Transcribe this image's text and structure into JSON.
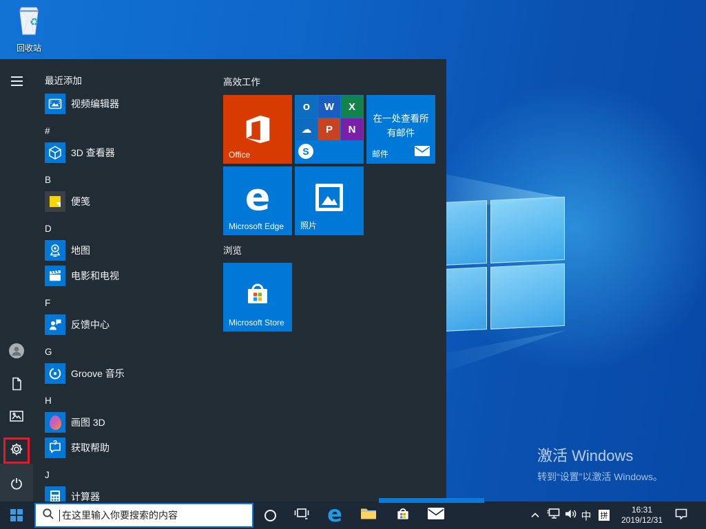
{
  "desktop": {
    "recycle_bin_label": "回收站",
    "watermark": {
      "title": "激活 Windows",
      "subtitle": "转到“设置”以激活 Windows。"
    }
  },
  "start_menu": {
    "app_list": {
      "items": [
        {
          "type": "header",
          "label": "最近添加"
        },
        {
          "type": "app",
          "label": "视频编辑器",
          "icon": "video-editor-icon"
        },
        {
          "type": "header",
          "label": "#"
        },
        {
          "type": "app",
          "label": "3D 查看器",
          "icon": "3d-viewer-icon"
        },
        {
          "type": "header",
          "label": "B"
        },
        {
          "type": "app",
          "label": "便笺",
          "icon": "sticky-notes-icon"
        },
        {
          "type": "header",
          "label": "D"
        },
        {
          "type": "app",
          "label": "地图",
          "icon": "maps-icon"
        },
        {
          "type": "app",
          "label": "电影和电视",
          "icon": "movies-tv-icon"
        },
        {
          "type": "header",
          "label": "F"
        },
        {
          "type": "app",
          "label": "反馈中心",
          "icon": "feedback-hub-icon"
        },
        {
          "type": "header",
          "label": "G"
        },
        {
          "type": "app",
          "label": "Groove 音乐",
          "icon": "groove-music-icon"
        },
        {
          "type": "header",
          "label": "H"
        },
        {
          "type": "app",
          "label": "画图 3D",
          "icon": "paint-3d-icon"
        },
        {
          "type": "app",
          "label": "获取帮助",
          "icon": "get-help-icon"
        },
        {
          "type": "header",
          "label": "J"
        },
        {
          "type": "app",
          "label": "计算器",
          "icon": "calculator-icon"
        }
      ]
    },
    "tiles": {
      "group1_header": "高效工作",
      "group2_header": "浏览",
      "office_label": "Office",
      "mail_text": "在一处查看所有邮件",
      "mail_label": "邮件",
      "edge_label": "Microsoft Edge",
      "photos_label": "照片",
      "store_label": "Microsoft Store",
      "office_mini_letters": {
        "outlook": "o",
        "word": "W",
        "excel": "X",
        "powerpoint": "P",
        "onenote": "N",
        "skype": "S"
      }
    }
  },
  "taskbar": {
    "search_placeholder": "在这里输入你要搜索的内容",
    "tray": {
      "ime_lang": "中",
      "ime_pinyin": "拼",
      "time": "16:31",
      "date": "2019/12/31"
    }
  },
  "icons": {
    "edge_letter": "e",
    "onedrive_cloud_glyph": "☁",
    "recycle_glyph": "♻",
    "question_glyph": "?"
  },
  "colors": {
    "accent_blue": "#0078d7",
    "office_orange": "#d83b01",
    "annotation_red": "#e9182c",
    "menu_bg": "#212c35",
    "taskbar_bg": "#1d2836"
  }
}
